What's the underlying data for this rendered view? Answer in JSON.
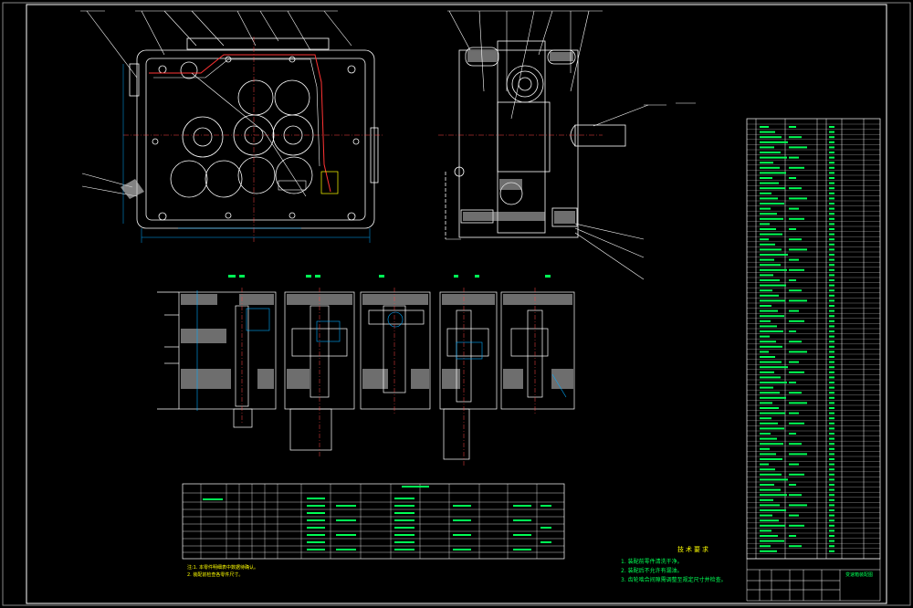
{
  "drawing": {
    "background": "#000000",
    "colors": {
      "frame": "#ffffff",
      "outline": "#ffffff",
      "leader": "#ffffff",
      "dimension": "#00aaff",
      "text_green": "#00ff55",
      "text_yellow": "#ffff00",
      "hatch": "#c8c8c8",
      "pipe": "#ff3333",
      "centerline": "#ff4444"
    },
    "tech_requirements": {
      "heading": "技术要求",
      "items": [
        "1. 装配前零件清洗干净。",
        "2. 装配后不允许有漏油。",
        "3. 齿轮啮合间隙需调整至规定尺寸并检查。"
      ]
    },
    "footnotes": [
      "注:1. 本零件明细表中数据待确认。",
      "2. 装配前检查各零件尺寸。"
    ],
    "title_block": {
      "name": "变速箱装配图"
    }
  }
}
